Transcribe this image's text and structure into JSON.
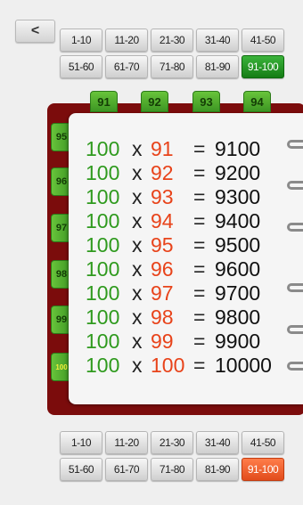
{
  "back_button": {
    "label": "<"
  },
  "top_ranges": [
    {
      "label": "1-10"
    },
    {
      "label": "11-20"
    },
    {
      "label": "21-30"
    },
    {
      "label": "31-40"
    },
    {
      "label": "41-50"
    },
    {
      "label": "51-60"
    },
    {
      "label": "61-70"
    },
    {
      "label": "71-80"
    },
    {
      "label": "81-90"
    },
    {
      "label": "91-100"
    }
  ],
  "bottom_ranges": [
    {
      "label": "1-10"
    },
    {
      "label": "11-20"
    },
    {
      "label": "21-30"
    },
    {
      "label": "31-40"
    },
    {
      "label": "41-50"
    },
    {
      "label": "51-60"
    },
    {
      "label": "61-70"
    },
    {
      "label": "71-80"
    },
    {
      "label": "81-90"
    },
    {
      "label": "91-100"
    }
  ],
  "top_tabs": [
    "91",
    "92",
    "93",
    "94"
  ],
  "side_tabs": [
    "95",
    "96",
    "97",
    "98",
    "99",
    "100"
  ],
  "equations": [
    {
      "a": "100",
      "op": "x",
      "b": "91",
      "eq": "=",
      "result": "9100"
    },
    {
      "a": "100",
      "op": "x",
      "b": "92",
      "eq": "=",
      "result": "9200"
    },
    {
      "a": "100",
      "op": "x",
      "b": "93",
      "eq": "=",
      "result": "9300"
    },
    {
      "a": "100",
      "op": "x",
      "b": "94",
      "eq": "=",
      "result": "9400"
    },
    {
      "a": "100",
      "op": "x",
      "b": "95",
      "eq": "=",
      "result": "9500"
    },
    {
      "a": "100",
      "op": "x",
      "b": "96",
      "eq": "=",
      "result": "9600"
    },
    {
      "a": "100",
      "op": "x",
      "b": "97",
      "eq": "=",
      "result": "9700"
    },
    {
      "a": "100",
      "op": "x",
      "b": "98",
      "eq": "=",
      "result": "9800"
    },
    {
      "a": "100",
      "op": "x",
      "b": "99",
      "eq": "=",
      "result": "9900"
    },
    {
      "a": "100",
      "op": "x",
      "b": "100",
      "eq": "=",
      "result": "10000"
    }
  ],
  "colors": {
    "multiplicand": "#2f9a1e",
    "multiplier": "#e8431a",
    "book_cover": "#7b0c0c",
    "active_top": "#157d15",
    "active_bottom": "#e24c1c"
  }
}
